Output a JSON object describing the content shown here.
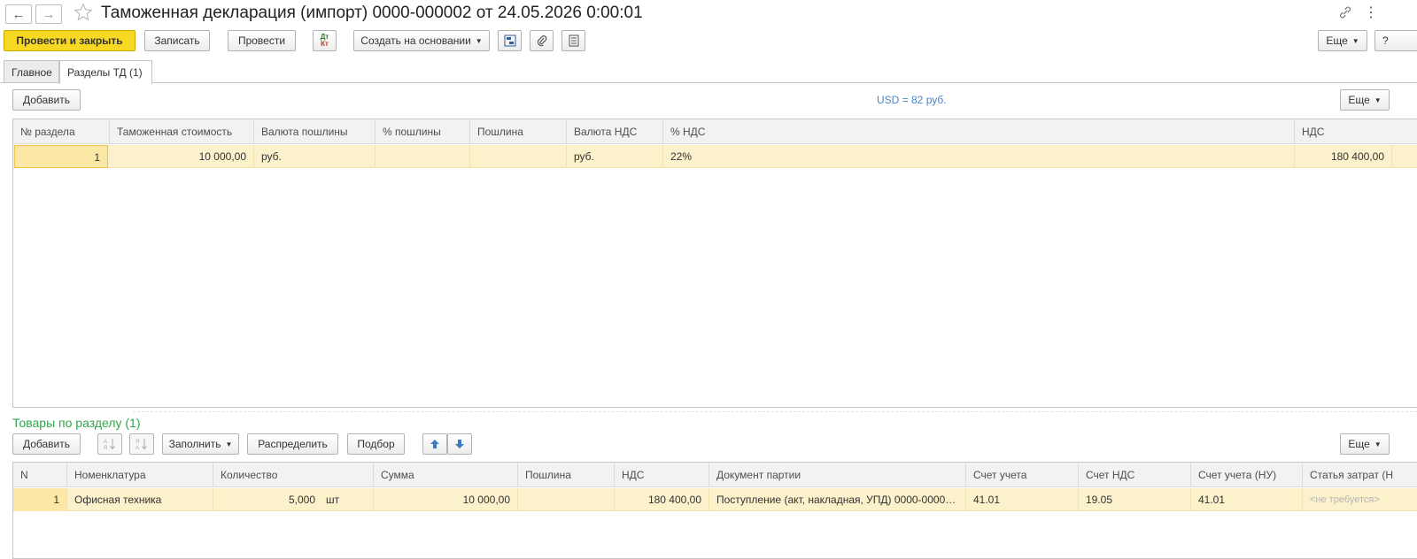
{
  "titlebar": {
    "back_glyph": "←",
    "forward_glyph": "→",
    "title": "Таможенная декларация (импорт) 0000-000002 от 24.05.2026 0:00:01",
    "kebab_glyph": "⋮"
  },
  "toolbar": {
    "post_close": "Провести и закрыть",
    "save": "Записать",
    "post": "Провести",
    "dt_kt_top": "Дт",
    "dt_kt_bottom": "Кт",
    "create_based": "Создать на основании",
    "more": "Еще",
    "help": "?"
  },
  "tabs": [
    {
      "label": "Главное"
    },
    {
      "label": "Разделы ТД (1)"
    }
  ],
  "sections": {
    "add": "Добавить",
    "rate": "USD = 82 руб.",
    "more": "Еще",
    "columns": [
      "№ раздела",
      "Таможенная стоимость",
      "Валюта пошлины",
      "% пошлины",
      "Пошлина",
      "Валюта НДС",
      "% НДС",
      "НДС"
    ],
    "rows": [
      {
        "num": "1",
        "customs_value": "10 000,00",
        "duty_currency": "руб.",
        "duty_percent": "",
        "duty": "",
        "vat_currency": "руб.",
        "vat_percent": "22%",
        "vat": "180 400,00"
      }
    ]
  },
  "goods": {
    "title": "Товары по разделу (1)",
    "add": "Добавить",
    "fill": "Заполнить",
    "distribute": "Распределить",
    "pick": "Подбор",
    "more": "Еще",
    "columns": [
      "N",
      "Номенклатура",
      "Количество",
      "Сумма",
      "Пошлина",
      "НДС",
      "Документ партии",
      "Счет учета",
      "Счет НДС",
      "Счет учета (НУ)",
      "Статья затрат (Н"
    ],
    "rows": [
      {
        "n": "1",
        "item": "Офисная  техника",
        "qty": "5,000",
        "unit": "шт",
        "sum": "10 000,00",
        "duty": "",
        "vat": "180 400,00",
        "batch_doc": "Поступление (акт, накладная, УПД) 0000-00001...",
        "account": "41.01",
        "vat_account": "19.05",
        "tax_account": "41.01",
        "cost_item": "<не требуется>"
      }
    ]
  },
  "colors": {
    "primary_button": "#f7d923",
    "row_highlight": "#fbf1cb",
    "section_title": "#2da84a",
    "rate_text": "#4a86c8"
  }
}
